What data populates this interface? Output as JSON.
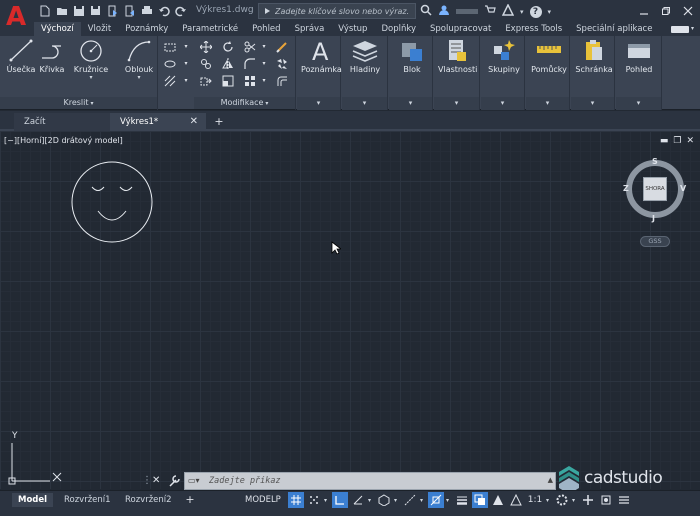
{
  "title_bar": {
    "app_logo": "A",
    "document_title": "Výkres1.dwg",
    "search_placeholder": "Zadejte klíčové slovo nebo výraz.",
    "help_label": "?"
  },
  "ribbon_tabs": [
    {
      "label": "Výchozí",
      "active": true
    },
    {
      "label": "Vložit"
    },
    {
      "label": "Poznámky"
    },
    {
      "label": "Parametrické"
    },
    {
      "label": "Pohled"
    },
    {
      "label": "Správa"
    },
    {
      "label": "Výstup"
    },
    {
      "label": "Doplňky"
    },
    {
      "label": "Spolupracovat"
    },
    {
      "label": "Express Tools"
    },
    {
      "label": "Speciální aplikace"
    }
  ],
  "ribbon": {
    "draw_panel": {
      "title": "Kreslit",
      "tools": [
        "Úsečka",
        "Křivka",
        "Kružnice",
        "Oblouk"
      ]
    },
    "modify_panel": {
      "title": "Modifikace"
    },
    "right_panels": [
      "Poznámka",
      "Hladiny",
      "Blok",
      "Vlastnosti",
      "Skupiny",
      "Pomůcky",
      "Schránka",
      "Pohled"
    ]
  },
  "file_tabs": {
    "start": "Začít",
    "document": "Výkres1*",
    "close_glyph": "✕",
    "add_glyph": "+"
  },
  "viewport": {
    "label": "[−][Horní][2D drátový model]",
    "viewcube": {
      "north": "S",
      "south": "J",
      "east": "V",
      "west": "Z",
      "face": "SHORA",
      "wcs_label": "GSS"
    },
    "ucs": {
      "x_label": "X",
      "y_label": "Y"
    }
  },
  "command_line": {
    "placeholder": "Zadejte příkaz",
    "close_glyph": "✕"
  },
  "watermark": {
    "text": "cadstudio"
  },
  "status_bar": {
    "layout_tabs": [
      "Model",
      "Rozvržení1",
      "Rozvržení2"
    ],
    "active_layout": "Model",
    "add_glyph": "+",
    "space_label": "MODELP",
    "annotation_scale": "1:1"
  },
  "colors": {
    "accent_blue": "#3b7fd1",
    "app_red": "#d92a2a",
    "canvas_bg": "#222933",
    "ribbon_bg": "#3b4453"
  }
}
